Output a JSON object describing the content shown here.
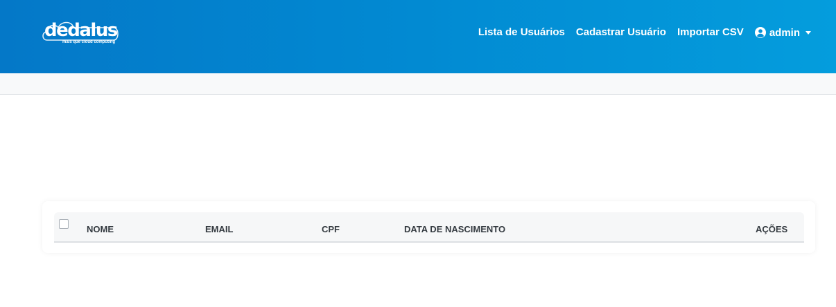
{
  "app": {
    "logo_text": "dedalus",
    "logo_tagline": "mais que cloud computing"
  },
  "nav": {
    "users_list": "Lista de Usuários",
    "register_user": "Cadastrar Usuário",
    "import_csv": "Importar CSV",
    "user_name": "admin",
    "user_icon": "user-circle-icon",
    "caret_icon": "caret-down-icon"
  },
  "table": {
    "select_all_checked": false,
    "columns": [
      "NOME",
      "EMAIL",
      "CPF",
      "DATA DE NASCIMENTO",
      "AÇÕES"
    ],
    "rows": []
  },
  "colors": {
    "navbar_start": "#0478c8",
    "navbar_end": "#049ddd",
    "subbar": "#f8f9fa",
    "table_header": "#f6f7f8"
  }
}
